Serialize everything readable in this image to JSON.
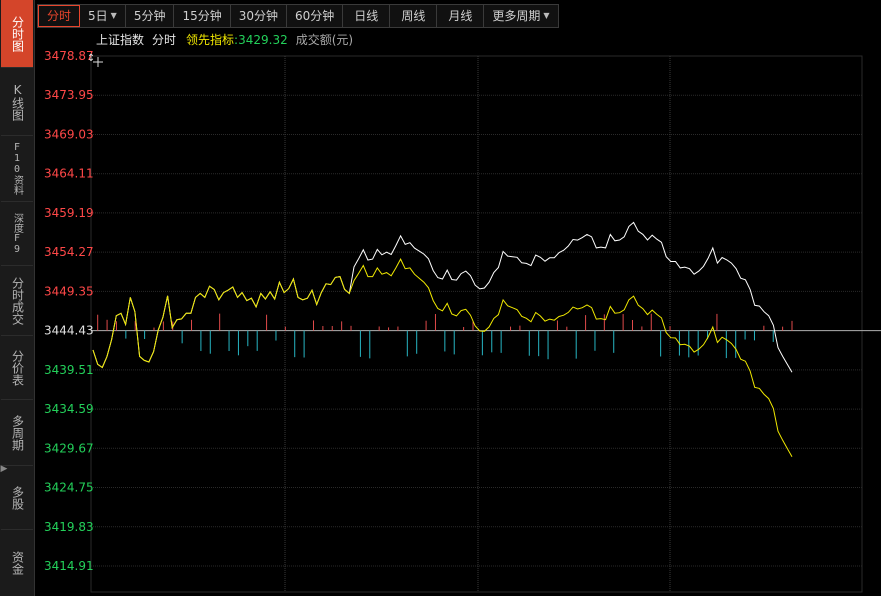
{
  "sidebar": {
    "items": [
      {
        "label": "分时图",
        "active": true
      },
      {
        "label": "K线图"
      },
      {
        "label": "F10资料"
      },
      {
        "label": "深度F9"
      },
      {
        "label": "分时成交"
      },
      {
        "label": "分价表"
      },
      {
        "label": "多周期"
      },
      {
        "label": "多股"
      },
      {
        "label": "资金"
      }
    ]
  },
  "tabs": [
    {
      "label": "分时",
      "active": true
    },
    {
      "label": "5日",
      "dropdown": true
    },
    {
      "label": "5分钟"
    },
    {
      "label": "15分钟"
    },
    {
      "label": "30分钟"
    },
    {
      "label": "60分钟"
    },
    {
      "label": "日线"
    },
    {
      "label": "周线"
    },
    {
      "label": "月线"
    },
    {
      "label": "更多周期",
      "dropdown": true
    }
  ],
  "info": {
    "index_name": "上证指数",
    "period": "分时",
    "leading_label": "领先指标",
    "leading_value": ":3429.32",
    "volume_label": "成交额(元)"
  },
  "colors": {
    "up": "#ff4848",
    "down": "#23d05a",
    "price_line": "#ffffff",
    "leading_line": "#f0e800",
    "vol_up": "#e04a4a",
    "vol_down": "#27b6c4",
    "grid": "#2a2a2a",
    "baseline": "#b0b0b0"
  },
  "icons": {
    "crosshair": "plus-icon",
    "collapse": "chevron-right-icon"
  },
  "chart_data": {
    "type": "line",
    "y_ticks": [
      3478.87,
      3473.95,
      3469.03,
      3464.11,
      3459.19,
      3454.27,
      3449.35,
      3444.43,
      3439.51,
      3434.59,
      3429.67,
      3424.75,
      3419.83,
      3414.91
    ],
    "prev_close": 3444.43,
    "ylim": [
      3413.0,
      3478.87
    ],
    "x_count": 150,
    "series": [
      {
        "key": "price",
        "points": [
          [
            0,
            3442.0
          ],
          [
            2,
            3440.2
          ],
          [
            4,
            3439.8
          ],
          [
            6,
            3441.2
          ],
          [
            8,
            3443.3
          ],
          [
            10,
            3446.3
          ],
          [
            12,
            3446.6
          ],
          [
            14,
            3445.2
          ],
          [
            16,
            3448.6
          ],
          [
            18,
            3446.8
          ],
          [
            20,
            3441.2
          ],
          [
            22,
            3440.7
          ],
          [
            24,
            3440.5
          ],
          [
            26,
            3441.8
          ],
          [
            28,
            3444.5
          ],
          [
            30,
            3446.1
          ],
          [
            32,
            3448.8
          ],
          [
            34,
            3444.8
          ],
          [
            36,
            3445.8
          ],
          [
            38,
            3445.9
          ],
          [
            40,
            3446.6
          ],
          [
            42,
            3446.6
          ],
          [
            44,
            3448.6
          ],
          [
            46,
            3449.1
          ],
          [
            48,
            3448.6
          ],
          [
            50,
            3450.0
          ],
          [
            52,
            3449.6
          ],
          [
            54,
            3448.3
          ],
          [
            56,
            3449.2
          ],
          [
            58,
            3449.5
          ],
          [
            60,
            3449.9
          ],
          [
            62,
            3448.6
          ],
          [
            64,
            3449.2
          ],
          [
            66,
            3448.2
          ],
          [
            68,
            3448.5
          ],
          [
            70,
            3447.4
          ],
          [
            72,
            3449.1
          ],
          [
            74,
            3448.4
          ],
          [
            76,
            3449.3
          ],
          [
            78,
            3448.4
          ],
          [
            80,
            3450.5
          ],
          [
            82,
            3449.2
          ],
          [
            84,
            3449.7
          ],
          [
            86,
            3450.9
          ],
          [
            88,
            3448.6
          ],
          [
            90,
            3448.3
          ],
          [
            92,
            3448.5
          ],
          [
            94,
            3449.5
          ],
          [
            96,
            3447.7
          ],
          [
            98,
            3449.2
          ],
          [
            100,
            3450.3
          ],
          [
            102,
            3450.2
          ],
          [
            104,
            3451.1
          ],
          [
            106,
            3451.2
          ],
          [
            108,
            3449.6
          ],
          [
            110,
            3449.1
          ],
          [
            112,
            3450.7
          ],
          [
            114,
            3451.6
          ],
          [
            116,
            3452.6
          ],
          [
            118,
            3451.2
          ],
          [
            120,
            3451.2
          ],
          [
            122,
            3452.3
          ],
          [
            124,
            3451.5
          ],
          [
            126,
            3451.7
          ],
          [
            128,
            3451.3
          ],
          [
            130,
            3452.3
          ],
          [
            132,
            3453.4
          ],
          [
            134,
            3452.2
          ],
          [
            136,
            3452.3
          ],
          [
            138,
            3451.5
          ],
          [
            140,
            3451.0
          ],
          [
            142,
            3450.5
          ],
          [
            144,
            3449.8
          ],
          [
            146,
            3448.2
          ],
          [
            148,
            3447.2
          ],
          [
            150,
            3446.9
          ],
          [
            152,
            3447.9
          ],
          [
            154,
            3446.6
          ],
          [
            156,
            3446.4
          ],
          [
            158,
            3447.1
          ],
          [
            160,
            3447.3
          ],
          [
            162,
            3446.6
          ],
          [
            164,
            3445.3
          ],
          [
            166,
            3444.7
          ],
          [
            168,
            3444.7
          ],
          [
            170,
            3445.3
          ],
          [
            172,
            3446.4
          ],
          [
            174,
            3446.9
          ],
          [
            176,
            3448.8
          ],
          [
            178,
            3448.1
          ],
          [
            180,
            3447.9
          ],
          [
            182,
            3447.7
          ],
          [
            184,
            3446.9
          ],
          [
            186,
            3446.7
          ],
          [
            188,
            3446.3
          ],
          [
            190,
            3447.5
          ],
          [
            192,
            3447.1
          ],
          [
            194,
            3446.5
          ],
          [
            196,
            3446.8
          ],
          [
            198,
            3446.7
          ],
          [
            200,
            3447.2
          ],
          [
            202,
            3447.4
          ],
          [
            204,
            3447.8
          ],
          [
            206,
            3448.5
          ],
          [
            208,
            3448.3
          ],
          [
            210,
            3448.5
          ],
          [
            212,
            3448.9
          ],
          [
            214,
            3448.6
          ],
          [
            216,
            3447.2
          ],
          [
            218,
            3447.3
          ],
          [
            220,
            3447.2
          ],
          [
            222,
            3448.9
          ],
          [
            224,
            3448.1
          ],
          [
            226,
            3448.2
          ],
          [
            228,
            3448.6
          ],
          [
            230,
            3449.9
          ],
          [
            232,
            3450.4
          ],
          [
            234,
            3449.3
          ],
          [
            236,
            3448.9
          ],
          [
            238,
            3448.2
          ],
          [
            240,
            3448.8
          ],
          [
            242,
            3448.3
          ],
          [
            244,
            3447.9
          ],
          [
            246,
            3446.1
          ],
          [
            248,
            3445.5
          ],
          [
            250,
            3445.5
          ],
          [
            252,
            3444.7
          ],
          [
            254,
            3444.8
          ],
          [
            256,
            3444.6
          ],
          [
            258,
            3443.9
          ],
          [
            260,
            3444.3
          ],
          [
            262,
            3444.9
          ],
          [
            264,
            3445.9
          ],
          [
            266,
            3447.2
          ],
          [
            268,
            3445.3
          ],
          [
            270,
            3446.0
          ],
          [
            272,
            3445.7
          ],
          [
            274,
            3445.3
          ],
          [
            276,
            3444.6
          ],
          [
            278,
            3443.4
          ],
          [
            280,
            3443.2
          ],
          [
            282,
            3442.0
          ],
          [
            284,
            3440.0
          ],
          [
            286,
            3439.9
          ],
          [
            288,
            3439.2
          ],
          [
            290,
            3438.7
          ],
          [
            292,
            3437.5
          ],
          [
            294,
            3434.7
          ],
          [
            296,
            3433.6
          ],
          [
            298,
            3432.6
          ],
          [
            300,
            3431.6
          ]
        ],
        "scale_x": 0.5
      }
    ]
  }
}
